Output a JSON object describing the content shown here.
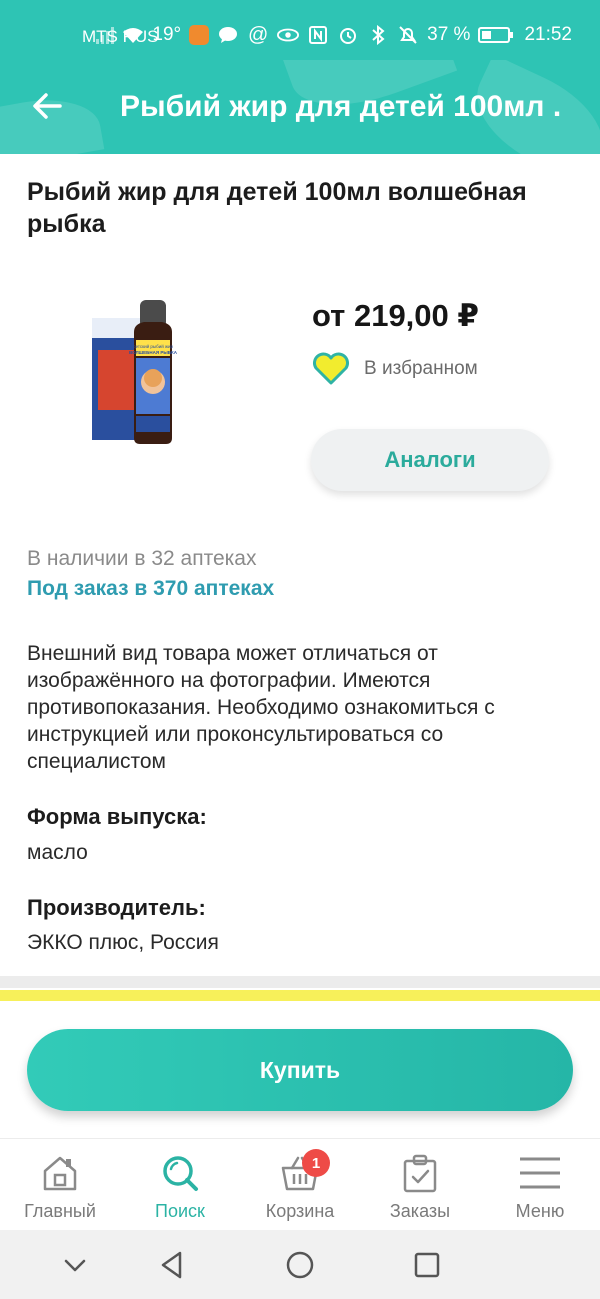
{
  "status_bar": {
    "carrier": "MTS RUS",
    "temperature": "19°",
    "battery": "37 %",
    "time": "21:52"
  },
  "header": {
    "title": "Рыбий жир для детей 100мл ..."
  },
  "product": {
    "title": "Рыбий жир для детей 100мл волшебная рыбка",
    "image_text": {
      "top_line": "детский рыбий жир",
      "name": "ВОЛШЕБНАЯ РЫБКА"
    },
    "price": "от 219,00 ₽",
    "favorite_label": "В избранном",
    "analogs_button": "Аналоги",
    "availability": "В наличии в 32 аптеках",
    "order_link": "Под заказ в 370 аптеках",
    "disclaimer": "Внешний вид товара может отличаться от изображённого на фотографии. Имеются противопоказания. Необходимо ознакомиться с инструкцией или проконсультироваться со специалистом",
    "form_label": "Форма выпуска:",
    "form_value": "масло",
    "manufacturer_label": "Производитель:",
    "manufacturer_value": "ЭККО плюс, Россия"
  },
  "buy_button": "Купить",
  "bottom_nav": {
    "items": [
      {
        "label": "Главный",
        "icon": "home-icon"
      },
      {
        "label": "Поиск",
        "icon": "search-icon"
      },
      {
        "label": "Корзина",
        "icon": "basket-icon"
      },
      {
        "label": "Заказы",
        "icon": "clipboard-icon"
      },
      {
        "label": "Меню",
        "icon": "menu-icon"
      }
    ],
    "active": "Поиск",
    "cart_count": "1"
  },
  "colors": {
    "brand": "#2ec4b4",
    "accent_text": "#2bab9c",
    "link": "#2f9cb0",
    "favorite_heart": "#f2ec2e",
    "badge": "#ee4b47"
  }
}
